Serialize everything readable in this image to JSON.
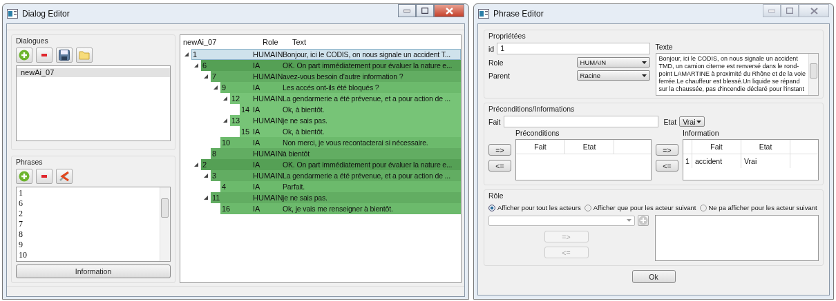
{
  "dialog_editor": {
    "title": "Dialog Editor",
    "dialogues": {
      "title": "Dialogues",
      "items": [
        {
          "label": "newAi_07",
          "selected": true
        }
      ]
    },
    "phrases": {
      "title": "Phrases",
      "items": [
        {
          "label": "1",
          "selected": false
        },
        {
          "label": "6",
          "selected": false
        },
        {
          "label": "2",
          "selected": false
        },
        {
          "label": "7",
          "selected": false
        },
        {
          "label": "8",
          "selected": false
        },
        {
          "label": "9",
          "selected": false
        },
        {
          "label": "10",
          "selected": false
        }
      ],
      "info_button": "Information"
    },
    "tree": {
      "columns": [
        "newAi_07",
        "Role",
        "Text"
      ],
      "rows": [
        {
          "id": "1",
          "role": "HUMAIN",
          "text": "Bonjour, ici le CODIS, on nous signale un accident T...",
          "selected": true,
          "expanded": true,
          "children": [
            {
              "id": "6",
              "role": "IA",
              "text": "OK. On part immédiatement pour évaluer la nature e...",
              "selected": false,
              "expanded": true,
              "children": [
                {
                  "id": "7",
                  "role": "HUMAIN",
                  "text": "avez-vous besoin d'autre information ?",
                  "selected": false,
                  "expanded": true,
                  "children": [
                    {
                      "id": "9",
                      "role": "IA",
                      "text": "Les accés ont-ils été bloqués ?",
                      "selected": false,
                      "expanded": true,
                      "children": [
                        {
                          "id": "12",
                          "role": "HUMAIN",
                          "text": "La gendarmerie a été prévenue, et a pour action de ...",
                          "selected": false,
                          "expanded": true,
                          "children": [
                            {
                              "id": "14",
                              "role": "IA",
                              "text": "Ok, à bientôt.",
                              "selected": false
                            }
                          ]
                        },
                        {
                          "id": "13",
                          "role": "HUMAIN",
                          "text": "je ne sais pas.",
                          "selected": false,
                          "expanded": true,
                          "children": [
                            {
                              "id": "15",
                              "role": "IA",
                              "text": "Ok, à bientôt.",
                              "selected": false
                            }
                          ]
                        }
                      ]
                    },
                    {
                      "id": "10",
                      "role": "IA",
                      "text": "Non merci, je vous recontacterai si nécessaire.",
                      "selected": false
                    }
                  ]
                },
                {
                  "id": "8",
                  "role": "HUMAIN",
                  "text": "à bientôt",
                  "selected": false
                }
              ]
            },
            {
              "id": "2",
              "role": "IA",
              "text": "OK. On part immédiatement pour évaluer la nature e...",
              "selected": false,
              "expanded": true,
              "children": [
                {
                  "id": "3",
                  "role": "HUMAIN",
                  "text": "La gendarmerie a été prévenue, et a pour action de ...",
                  "selected": false,
                  "expanded": true,
                  "children": [
                    {
                      "id": "4",
                      "role": "IA",
                      "text": "Parfait.",
                      "selected": false
                    }
                  ]
                },
                {
                  "id": "11",
                  "role": "HUMAIN",
                  "text": "je ne sais pas.",
                  "selected": false,
                  "expanded": true,
                  "children": [
                    {
                      "id": "16",
                      "role": "IA",
                      "text": "Ok, je vais me renseigner à bientôt.",
                      "selected": false
                    }
                  ]
                }
              ]
            }
          ]
        }
      ]
    }
  },
  "phrase_editor": {
    "title": "Phrase Editor",
    "properties": {
      "title": "Propriétées",
      "id_label": "id",
      "id_value": "1",
      "role_label": "Role",
      "role_value": "HUMAIN",
      "parent_label": "Parent",
      "parent_value": "Racine",
      "text_label": "Texte",
      "text_lines": [
        "Bonjour, ici le CODIS, on nous signale un accident",
        "TMD, un camion citerne est renversé dans le rond-",
        "point LAMARTINE à proximité du Rhône et de la voie",
        "ferrée.Le chauffeur est blessé.Un liquide se répand",
        "sur la chaussée, pas d'incendie déclaré pour l'instant"
      ]
    },
    "conditions": {
      "title": "Préconditions/Informations",
      "fact_label": "Fait",
      "state_label": "Etat",
      "state_value": "Vrai",
      "preconditions": {
        "title": "Préconditions",
        "buttons": [
          "=>",
          "<="
        ],
        "columns": [
          "Fait",
          "Etat"
        ]
      },
      "information": {
        "title": "Information",
        "buttons": [
          "=>",
          "<="
        ],
        "columns": [
          "Fait",
          "Etat"
        ],
        "rows": [
          {
            "index": "1",
            "fact": "accident",
            "state": "Vrai"
          }
        ]
      }
    },
    "role": {
      "title": "Rôle",
      "options": [
        {
          "label": "Afficher pour tout les acteurs",
          "selected": true
        },
        {
          "label": "Afficher que pour les acteur suivant",
          "selected": false
        },
        {
          "label": "Ne pa afficher pour les acteur suivant",
          "selected": false
        }
      ],
      "buttons": [
        {
          "label": "=>",
          "disabled": true
        },
        {
          "label": "<=",
          "disabled": true
        }
      ]
    },
    "ok_button": "Ok"
  }
}
